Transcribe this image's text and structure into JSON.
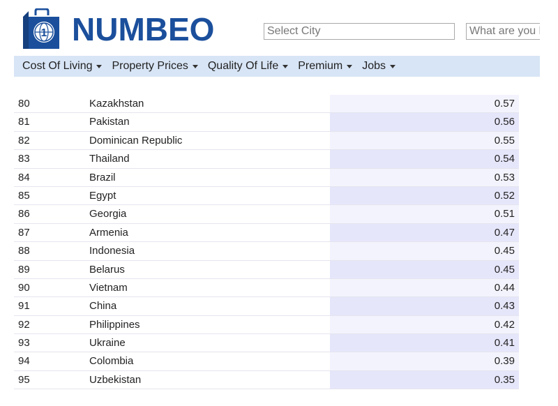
{
  "header": {
    "logo_text": "NUMBEO",
    "logo_icon": "numbeo-bag-icon",
    "search_city_placeholder": "Select City",
    "search_what_placeholder": "What are you looking for?"
  },
  "nav": {
    "items": [
      {
        "label": "Cost Of Living"
      },
      {
        "label": "Property Prices"
      },
      {
        "label": "Quality Of Life"
      },
      {
        "label": "Premium"
      },
      {
        "label": "Jobs"
      }
    ]
  },
  "table": {
    "rows": [
      {
        "rank": "80",
        "country": "Kazakhstan",
        "value": "0.57"
      },
      {
        "rank": "81",
        "country": "Pakistan",
        "value": "0.56"
      },
      {
        "rank": "82",
        "country": "Dominican Republic",
        "value": "0.55"
      },
      {
        "rank": "83",
        "country": "Thailand",
        "value": "0.54"
      },
      {
        "rank": "84",
        "country": "Brazil",
        "value": "0.53"
      },
      {
        "rank": "85",
        "country": "Egypt",
        "value": "0.52"
      },
      {
        "rank": "86",
        "country": "Georgia",
        "value": "0.51"
      },
      {
        "rank": "87",
        "country": "Armenia",
        "value": "0.47"
      },
      {
        "rank": "88",
        "country": "Indonesia",
        "value": "0.45"
      },
      {
        "rank": "89",
        "country": "Belarus",
        "value": "0.45"
      },
      {
        "rank": "90",
        "country": "Vietnam",
        "value": "0.44"
      },
      {
        "rank": "91",
        "country": "China",
        "value": "0.43"
      },
      {
        "rank": "92",
        "country": "Philippines",
        "value": "0.42"
      },
      {
        "rank": "93",
        "country": "Ukraine",
        "value": "0.41"
      },
      {
        "rank": "94",
        "country": "Colombia",
        "value": "0.39"
      },
      {
        "rank": "95",
        "country": "Uzbekistan",
        "value": "0.35"
      }
    ]
  },
  "colors": {
    "brand": "#1b4f9c",
    "navbar_bg": "#d8e5f6",
    "value_cell_even": "#f3f3fd",
    "value_cell_odd": "#e6e6fb"
  }
}
